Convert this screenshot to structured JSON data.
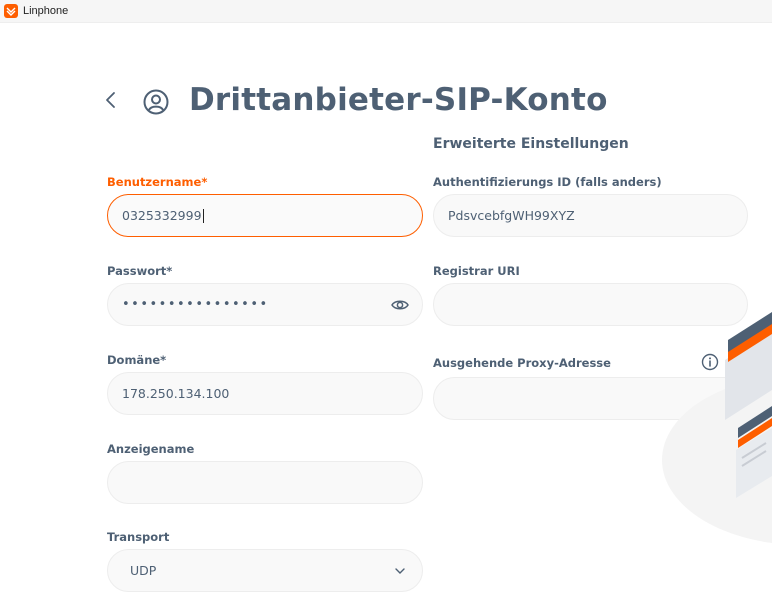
{
  "window": {
    "app_title": "Linphone"
  },
  "header": {
    "title": "Drittanbieter-SIP-Konto"
  },
  "form": {
    "username": {
      "label": "Benutzername*",
      "value": "0325332999"
    },
    "password": {
      "label": "Passwort*",
      "masked_value": "••••••••••••••••"
    },
    "domain": {
      "label": "Domäne*",
      "value": "178.250.134.100"
    },
    "display_name": {
      "label": "Anzeigename",
      "value": ""
    },
    "transport": {
      "label": "Transport",
      "selected": "UDP"
    }
  },
  "advanced": {
    "title": "Erweiterte Einstellungen",
    "auth_id": {
      "label": "Authentifizierungs ID (falls anders)",
      "value": "PdsvcebfgWH99XYZ"
    },
    "registrar_uri": {
      "label": "Registrar URI",
      "value": ""
    },
    "outbound_proxy": {
      "label": "Ausgehende Proxy-Adresse",
      "value": ""
    }
  },
  "icons": {
    "app": "linphone-logo-icon",
    "back": "chevron-left-icon",
    "account": "user-circle-icon",
    "password_toggle": "eye-icon",
    "dropdown": "chevron-down-icon",
    "info": "info-icon"
  },
  "colors": {
    "accent": "#fe5e00",
    "text": "#4e6074",
    "field_bg": "#f9f9f9",
    "field_border": "#ededed"
  }
}
